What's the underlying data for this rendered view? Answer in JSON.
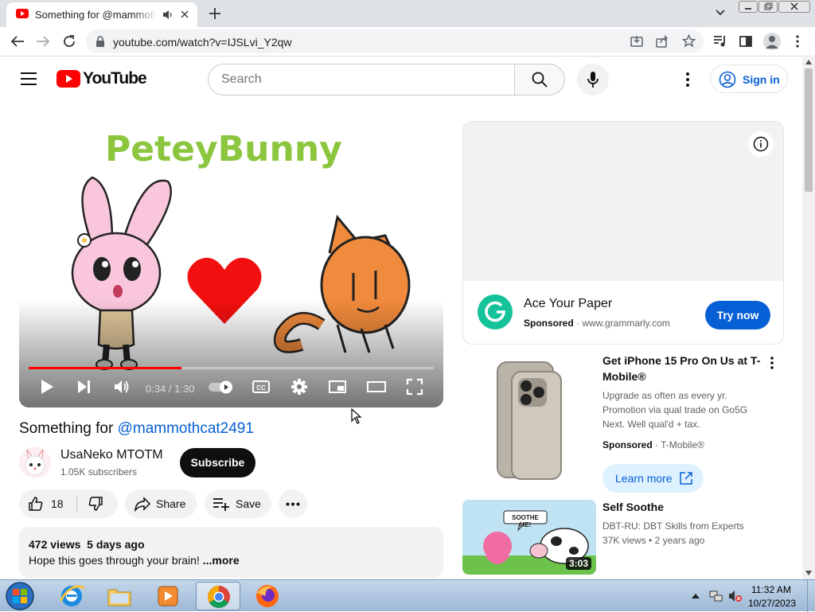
{
  "browser": {
    "tab_title": "Something for @mammothcat2491",
    "url": "youtube.com/watch?v=IJSLvi_Y2qw"
  },
  "header": {
    "logo_text": "YouTube",
    "search_placeholder": "Search",
    "signin_label": "Sign in"
  },
  "player": {
    "thumb_title": "PeteyBunny",
    "time_display": "0:34 / 1:30",
    "progress_fraction": 0.378
  },
  "video": {
    "title_prefix": "Something for ",
    "title_mention": "@mammothcat2491",
    "channel_name": "UsaNeko MTOTM",
    "subscribers": "1.05K subscribers",
    "subscribe_label": "Subscribe",
    "like_count": "18",
    "share_label": "Share",
    "save_label": "Save",
    "views": "472 views",
    "age": "5 days ago",
    "description": "Hope this goes through your brain!",
    "more_label": "...more"
  },
  "ad": {
    "title": "Ace Your Paper",
    "sponsored": "Sponsored",
    "domain": "www.grammarly.com",
    "cta": "Try now"
  },
  "recommendations": [
    {
      "title": "Get iPhone 15 Pro On Us at T-Mobile®",
      "desc": "Upgrade as often as every yr. Promotion via qual trade on Go5G Next. Well qual'd + tax.",
      "sponsored": "Sponsored",
      "advertiser": "T-Mobile®",
      "cta": "Learn more"
    },
    {
      "title": "Self Soothe",
      "channel": "DBT-RU: DBT Skills from Experts",
      "views": "37K views",
      "age": "2 years ago",
      "duration": "3:03",
      "thumb_caption": "SOOTHE ME!"
    }
  ],
  "taskbar": {
    "time": "11:32 AM",
    "date": "10/27/2023"
  }
}
